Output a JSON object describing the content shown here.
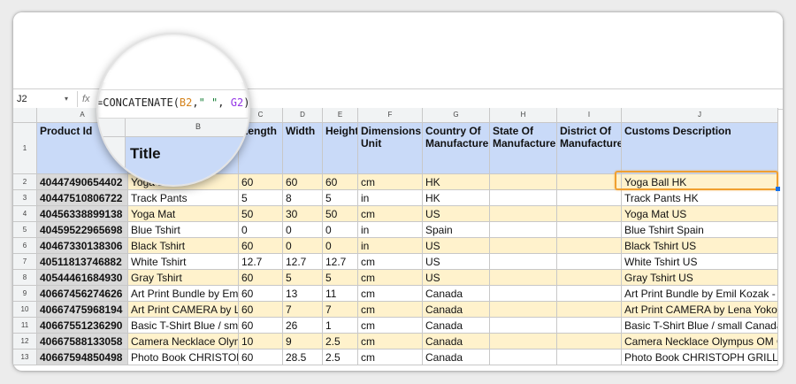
{
  "formula_bar": {
    "name_box": "J2",
    "name_box_arrow": "▾",
    "fx_icon": "fx",
    "formula_prefix": "=CONCATENATE(",
    "formula_ref1": "B2",
    "formula_sep1": ",",
    "formula_str": "\" \"",
    "formula_sep2": ", ",
    "formula_ref2": "G2",
    "formula_suffix": ")"
  },
  "columns": [
    "A",
    "B",
    "C",
    "D",
    "E",
    "F",
    "G",
    "H",
    "I",
    "J"
  ],
  "header_row": {
    "row_number": "1",
    "labels": [
      "Product Id",
      "Title",
      "Length",
      "Width",
      "Height",
      "Dimensions Unit",
      "Country Of Manufacture",
      "State Of Manufacture",
      "District Of Manufacture",
      "Customs Description"
    ]
  },
  "rows": [
    {
      "n": "2",
      "cells": [
        "40447490654402",
        "Yoga Ball",
        "60",
        "60",
        "60",
        "cm",
        "HK",
        "",
        "",
        "Yoga Ball HK"
      ]
    },
    {
      "n": "3",
      "cells": [
        "40447510806722",
        "Track Pants",
        "5",
        "8",
        "5",
        "in",
        "HK",
        "",
        "",
        "Track Pants HK"
      ]
    },
    {
      "n": "4",
      "cells": [
        "40456338899138",
        "Yoga Mat",
        "50",
        "30",
        "50",
        "cm",
        "US",
        "",
        "",
        "Yoga Mat US"
      ]
    },
    {
      "n": "5",
      "cells": [
        "40459522965698",
        "Blue Tshirt",
        "0",
        "0",
        "0",
        "in",
        "Spain",
        "",
        "",
        "Blue Tshirt Spain"
      ]
    },
    {
      "n": "6",
      "cells": [
        "40467330138306",
        "Black Tshirt",
        "60",
        "0",
        "0",
        "in",
        "US",
        "",
        "",
        "Black Tshirt US"
      ]
    },
    {
      "n": "7",
      "cells": [
        "40511813746882",
        "White Tshirt",
        "12.7",
        "12.7",
        "12.7",
        "cm",
        "US",
        "",
        "",
        "White Tshirt US"
      ]
    },
    {
      "n": "8",
      "cells": [
        "40544461684930",
        "Gray Tshirt",
        "60",
        "5",
        "5",
        "cm",
        "US",
        "",
        "",
        "Gray Tshirt US"
      ]
    },
    {
      "n": "9",
      "cells": [
        "40667456274626",
        "Art Print Bundle by Emil Kozak",
        "60",
        "13",
        "11",
        "cm",
        "Canada",
        "",
        "",
        "Art Print Bundle by Emil Kozak - L"
      ]
    },
    {
      "n": "10",
      "cells": [
        "40667475968194",
        "Art Print CAMERA by Lena Yokoyama",
        "60",
        "7",
        "7",
        "cm",
        "Canada",
        "",
        "",
        "Art Print CAMERA by Lena Yokoy"
      ]
    },
    {
      "n": "11",
      "cells": [
        "40667551236290",
        "Basic T-Shirt Blue / small",
        "60",
        "26",
        "1",
        "cm",
        "Canada",
        "",
        "",
        "Basic T-Shirt Blue / small Canada"
      ]
    },
    {
      "n": "12",
      "cells": [
        "40667588133058",
        "Camera Necklace Olympus OM",
        "10",
        "9",
        "2.5",
        "cm",
        "Canada",
        "",
        "",
        "Camera Necklace Olympus OM C"
      ]
    },
    {
      "n": "13",
      "cells": [
        "40667594850498",
        "Photo Book CHRISTOPH GRILL",
        "60",
        "28.5",
        "2.5",
        "cm",
        "Canada",
        "",
        "",
        "Photo Book CHRISTOPH GRILL"
      ]
    }
  ],
  "colors": {
    "header_fill": "#c9daf8",
    "band_fill": "#fff2cc",
    "selection_border": "#f0a030"
  }
}
